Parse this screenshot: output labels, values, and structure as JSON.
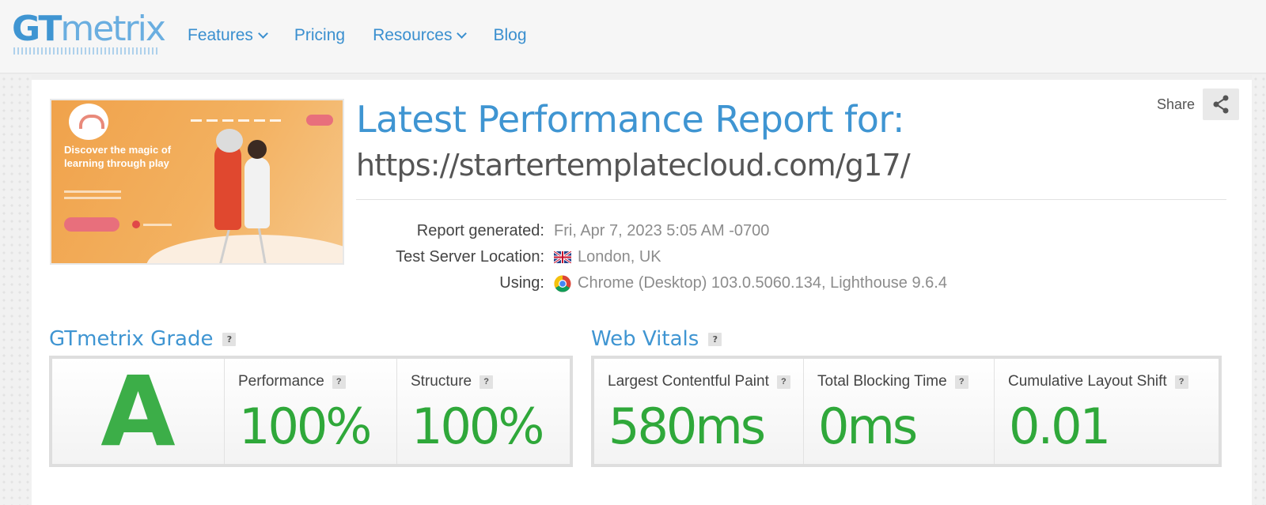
{
  "header": {
    "logo_primary": "GT",
    "logo_secondary": "metrix",
    "nav": [
      {
        "label": "Features",
        "has_dropdown": true
      },
      {
        "label": "Pricing",
        "has_dropdown": false
      },
      {
        "label": "Resources",
        "has_dropdown": true
      },
      {
        "label": "Blog",
        "has_dropdown": false
      }
    ]
  },
  "thumbnail": {
    "headline": "Discover the magic of learning through play"
  },
  "report": {
    "title": "Latest Performance Report for:",
    "url": "https://startertemplatecloud.com/g17/",
    "share_label": "Share",
    "meta": [
      {
        "key": "Report generated:",
        "value": "Fri, Apr 7, 2023 5:05 AM -0700",
        "icon": ""
      },
      {
        "key": "Test Server Location:",
        "value": "London, UK",
        "icon": "uk-flag-icon"
      },
      {
        "key": "Using:",
        "value": "Chrome (Desktop) 103.0.5060.134, Lighthouse 9.6.4",
        "icon": "chrome-icon"
      }
    ]
  },
  "grade": {
    "title": "GTmetrix Grade",
    "help": "?",
    "letter": "A",
    "performance_label": "Performance",
    "performance_value": "100%",
    "structure_label": "Structure",
    "structure_value": "100%"
  },
  "vitals": {
    "title": "Web Vitals",
    "help": "?",
    "items": [
      {
        "label": "Largest Contentful Paint",
        "value": "580ms"
      },
      {
        "label": "Total Blocking Time",
        "value": "0ms"
      },
      {
        "label": "Cumulative Layout Shift",
        "value": "0.01"
      }
    ]
  },
  "colors": {
    "brand_blue": "#3f95d2",
    "good_green": "#2fa83a"
  }
}
